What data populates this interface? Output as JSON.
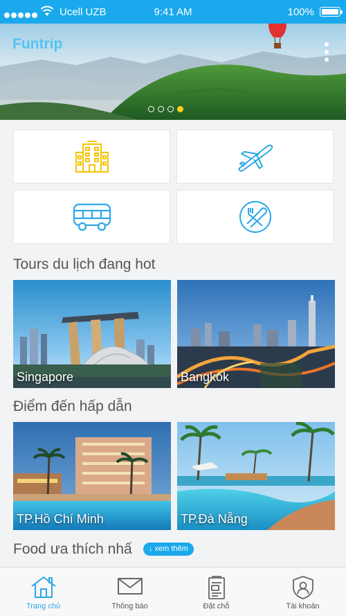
{
  "status_bar": {
    "carrier": "Ucell UZB",
    "time": "9:41 AM",
    "battery": "100%"
  },
  "header": {
    "title": "Funtrip"
  },
  "hero": {
    "slide_count": 4,
    "active_slide": 4
  },
  "categories": [
    {
      "icon": "hotel-icon"
    },
    {
      "icon": "airplane-icon"
    },
    {
      "icon": "bus-icon"
    },
    {
      "icon": "restaurant-icon"
    }
  ],
  "hot_tours": {
    "title": "Tours du lịch đang hot",
    "items": [
      {
        "label": "Singapore"
      },
      {
        "label": "Bangkok"
      }
    ]
  },
  "destinations": {
    "title": "Điểm đến hấp dẫn",
    "items": [
      {
        "label": "TP.Hồ Chí Minh"
      },
      {
        "label": "TP.Đà Nẵng"
      }
    ]
  },
  "food": {
    "title": "Food ưa thích nhấ",
    "see_more": "↓ xem thêm"
  },
  "bottom_nav": [
    {
      "label": "Trang chủ",
      "icon": "home-icon",
      "active": true
    },
    {
      "label": "Thông báo",
      "icon": "mail-icon",
      "active": false
    },
    {
      "label": "Đặt chỗ",
      "icon": "booking-icon",
      "active": false
    },
    {
      "label": "Tài khoản",
      "icon": "account-icon",
      "active": false
    }
  ],
  "colors": {
    "accent": "#19a9ec",
    "active_dot": "#ffd21e",
    "icon_hotel": "#f5c400",
    "icon_blue": "#2aa7e8"
  }
}
